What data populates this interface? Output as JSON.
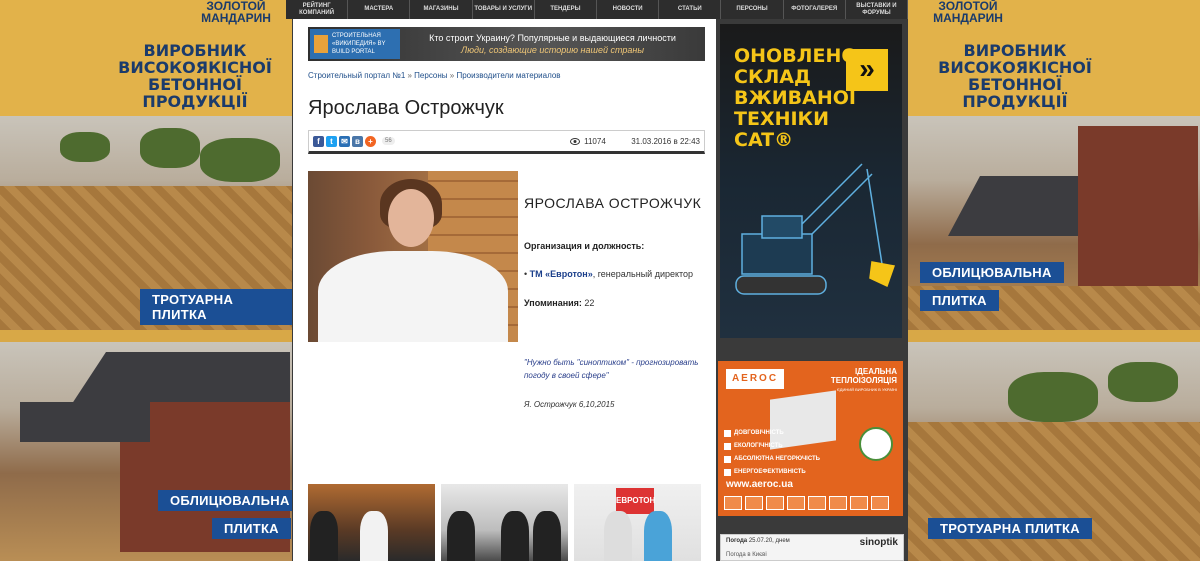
{
  "nav": {
    "items": [
      "РЕЙТИНГ КОМПАНИЙ",
      "МАСТЕРА",
      "МАГАЗИНЫ",
      "ТОВАРЫ И УСЛУГИ",
      "ТЕНДЕРЫ",
      "НОВОСТИ",
      "СТАТЬИ",
      "ПЕРСОНЫ",
      "ФОТОГАЛЕРЕЯ",
      "ВЫСТАВКИ И ФОРУМЫ"
    ]
  },
  "left_banner": {
    "logo": "ЗОЛОТОЙ\nМАНДАРИН",
    "headline": "ВИРОБНИК\nВИСОКОЯКІСНОЇ\nБЕТОННОЇ ПРОДУКЦІЇ",
    "tag_top": "ТРОТУАРНА ПЛИТКА",
    "tag_bottom_1": "ОБЛИЦЮВАЛЬНА",
    "tag_bottom_2": "ПЛИТКА"
  },
  "right_banner": {
    "logo": "ЗОЛОТОЙ\nМАНДАРИН",
    "headline": "ВИРОБНИК\nВИСОКОЯКІСНОЇ\nБЕТОННОЇ ПРОДУКЦІЇ",
    "tag_top_1": "ОБЛИЦЮВАЛЬНА",
    "tag_top_2": "ПЛИТКА",
    "tag_bottom": "ТРОТУАРНА ПЛИТКА"
  },
  "promo": {
    "logo_text": "СТРОИТЕЛЬНАЯ «ВИКИПЕДИЯ» BY BUILD PORTAL",
    "line1": "Кто строит Украину? Популярные и выдающиеся личности",
    "line2": "Люди, создающие историю нашей страны"
  },
  "breadcrumb": {
    "home": "Строительный портал №1",
    "sep": " » ",
    "persons": "Персоны",
    "category": "Производители материалов"
  },
  "page_title": "Ярослава Острожчук",
  "infobar": {
    "share_count": "56",
    "views": "11074",
    "date": "31.03.2016 в 22:43"
  },
  "person": {
    "name_caps": "ЯРОСЛАВА ОСТРОЖЧУК",
    "org_label": "Организация и должность:",
    "org_bullet": "•",
    "org_company": "ТМ «Евротон»",
    "org_position": ", генеральный директор",
    "mentions_label": "Упоминания:",
    "mentions_value": " 22",
    "quote": "\"Нужно быть \"синоптиком\" - прогнозировать погоду в своей сфере\"",
    "quote_signature": "Я. Острожчук 6,10,2015"
  },
  "gallery": {
    "thumb3_sign": "ЕВРОТОН"
  },
  "ad_cat": {
    "title": "ОНОВЛЕНО СКЛАД ВЖИВАНОЇ ТЕХНІКИ CAT®",
    "arrow": "»"
  },
  "ad_aeroc": {
    "logo": "AEROC",
    "headline": "ІДЕАЛЬНА\nТЕПЛОІЗОЛЯЦІЯ",
    "sub": "ЄДИНИЙ ВИРОБНИК В УКРАЇНІ",
    "features": [
      "ДОВГОВІЧНІСТЬ",
      "ЕКОЛОГІЧНІСТЬ",
      "АБСОЛЮТНА НЕГОРЮЧІСТЬ",
      "ЕНЕРГОЕФЕКТИВНІСТЬ"
    ],
    "url": "www.aeroc.ua"
  },
  "weather": {
    "label": "Погода",
    "date": "25.07.20, днем",
    "provider": "sinoptik",
    "city": "Погода в Києві"
  }
}
